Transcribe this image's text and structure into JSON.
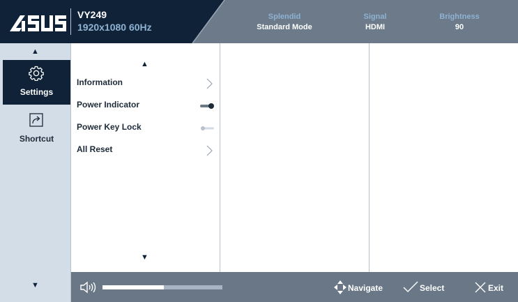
{
  "header": {
    "brand": "ASUS",
    "model": "VY249",
    "resolution": "1920x1080 60Hz",
    "stats": [
      {
        "label": "Splendid",
        "value": "Standard Mode"
      },
      {
        "label": "Signal",
        "value": "HDMI"
      },
      {
        "label": "Brightness",
        "value": "90"
      }
    ]
  },
  "rail": {
    "items": [
      {
        "label": "Settings",
        "icon": "gear-icon",
        "active": true
      },
      {
        "label": "Shortcut",
        "icon": "shortcut-icon",
        "active": false
      }
    ]
  },
  "menu": {
    "items": [
      {
        "label": "Information",
        "control": "chevron"
      },
      {
        "label": "Power Indicator",
        "control": "toggle",
        "state": "on"
      },
      {
        "label": "Power Key Lock",
        "control": "toggle",
        "state": "off"
      },
      {
        "label": "All Reset",
        "control": "chevron"
      }
    ]
  },
  "footer": {
    "volume_level": 0.51,
    "navigate_label": "Navigate",
    "select_label": "Select",
    "exit_label": "Exit"
  },
  "colors": {
    "header_dark": "#0f2238",
    "header_light": "#6c7a8a",
    "accent_blue": "#8fb2d2",
    "rail_bg": "#d3dde8",
    "footer_bg": "#697787"
  }
}
